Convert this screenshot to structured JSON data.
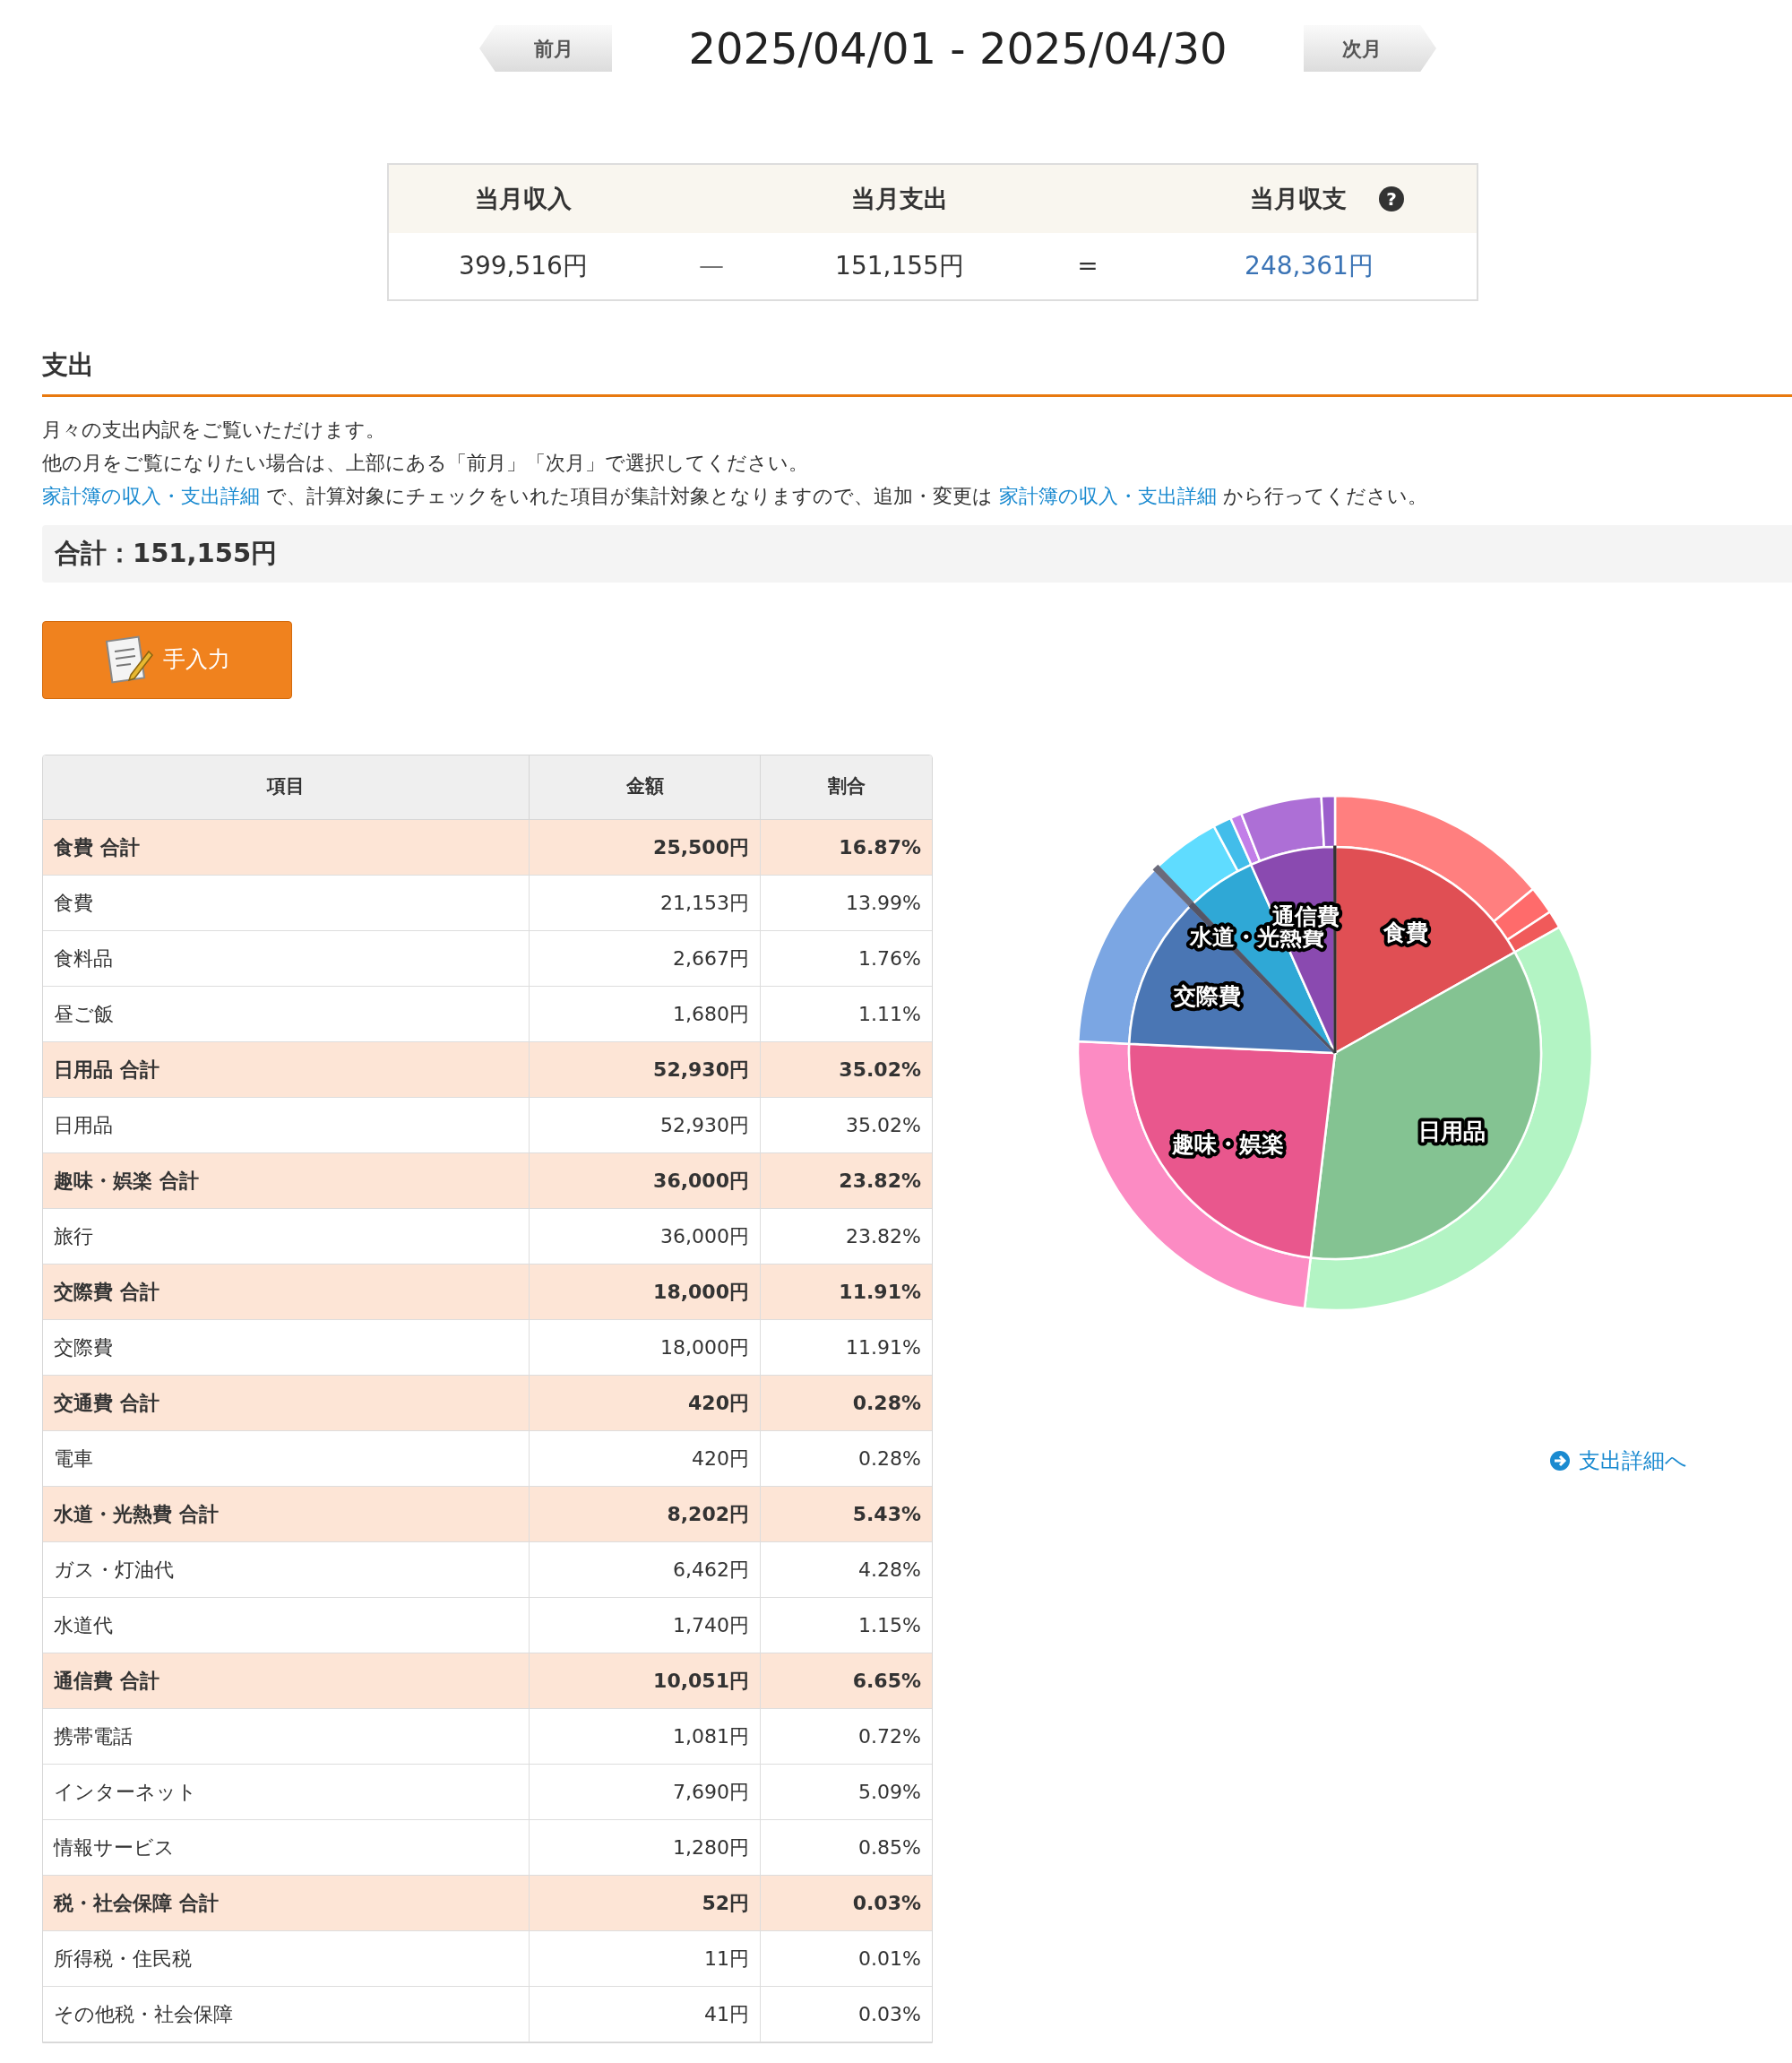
{
  "header": {
    "prev": "前月",
    "title": "2025/04/01 - 2025/04/30",
    "next": "次月"
  },
  "summary": {
    "columns": [
      "当月収入",
      "当月支出",
      "当月収支"
    ],
    "help": "?",
    "income": "399,516円",
    "minus": "—",
    "expense": "151,155円",
    "equals": "=",
    "balance": "248,361円"
  },
  "section": {
    "title": "支出",
    "lines": [
      {
        "text": "月々の支出内訳をご覧いただけます。"
      },
      {
        "text": "他の月をご覧になりたい場合は、上部にある「前月」「次月」で選択してください。"
      },
      {
        "parts": [
          {
            "link": "家計簿の収入・支出詳細"
          },
          {
            "text": " で、計算対象にチェックをいれた項目が集計対象となりますので、追加・変更は "
          },
          {
            "link": "家計簿の収入・支出詳細"
          },
          {
            "text": " から行ってください。"
          }
        ]
      }
    ],
    "total": "合計：151,155円",
    "manual_button": "手入力"
  },
  "table": {
    "columns": [
      "項目",
      "金額",
      "割合"
    ],
    "groups": [
      {
        "label": "食費 合計",
        "amount": "25,500円",
        "percent": "16.87%",
        "items": [
          {
            "label": "食費",
            "amount": "21,153円",
            "percent": "13.99%"
          },
          {
            "label": "食料品",
            "amount": "2,667円",
            "percent": "1.76%"
          },
          {
            "label": "昼ご飯",
            "amount": "1,680円",
            "percent": "1.11%"
          }
        ]
      },
      {
        "label": "日用品 合計",
        "amount": "52,930円",
        "percent": "35.02%",
        "items": [
          {
            "label": "日用品",
            "amount": "52,930円",
            "percent": "35.02%"
          }
        ]
      },
      {
        "label": "趣味・娯楽 合計",
        "amount": "36,000円",
        "percent": "23.82%",
        "items": [
          {
            "label": "旅行",
            "amount": "36,000円",
            "percent": "23.82%"
          }
        ]
      },
      {
        "label": "交際費 合計",
        "amount": "18,000円",
        "percent": "11.91%",
        "items": [
          {
            "label": "交際費",
            "amount": "18,000円",
            "percent": "11.91%"
          }
        ]
      },
      {
        "label": "交通費 合計",
        "amount": "420円",
        "percent": "0.28%",
        "items": [
          {
            "label": "電車",
            "amount": "420円",
            "percent": "0.28%"
          }
        ]
      },
      {
        "label": "水道・光熱費 合計",
        "amount": "8,202円",
        "percent": "5.43%",
        "items": [
          {
            "label": "ガス・灯油代",
            "amount": "6,462円",
            "percent": "4.28%"
          },
          {
            "label": "水道代",
            "amount": "1,740円",
            "percent": "1.15%"
          }
        ]
      },
      {
        "label": "通信費 合計",
        "amount": "10,051円",
        "percent": "6.65%",
        "items": [
          {
            "label": "携帯電話",
            "amount": "1,081円",
            "percent": "0.72%"
          },
          {
            "label": "インターネット",
            "amount": "7,690円",
            "percent": "5.09%"
          },
          {
            "label": "情報サービス",
            "amount": "1,280円",
            "percent": "0.85%"
          }
        ]
      },
      {
        "label": "税・社会保障 合計",
        "amount": "52円",
        "percent": "0.03%",
        "items": [
          {
            "label": "所得税・住民税",
            "amount": "11円",
            "percent": "0.01%"
          },
          {
            "label": "その他税・社会保障",
            "amount": "41円",
            "percent": "0.03%"
          }
        ]
      }
    ]
  },
  "chart_data": {
    "type": "pie",
    "series": [
      {
        "values": [
          16.87,
          35.02,
          23.82,
          11.91,
          0.28,
          5.43,
          6.65,
          0.03
        ],
        "colors": [
          "#e04f54",
          "#84c392",
          "#e9578d",
          "#4a76b4",
          "#555566",
          "#2fa8d6",
          "#8a4ab0",
          "#333333"
        ]
      },
      {
        "values": [
          13.99,
          1.76,
          1.11,
          35.02,
          23.82,
          11.91,
          0.28,
          4.28,
          1.15,
          0.72,
          5.09,
          0.85
        ],
        "colors": [
          "#ff7f7f",
          "#ff6b6b",
          "#f05a5a",
          "#b3f4c4",
          "#fc8bc3",
          "#7ba6e3",
          "#6b6b7b",
          "#5fdcff",
          "#42bdea",
          "#c27ee8",
          "#ad6fd6",
          "#9b5fcc"
        ]
      }
    ],
    "value_labels": [
      "食費",
      "日用品",
      "趣味・娯楽",
      "交際費",
      null,
      "水道・光熱費",
      "通信費",
      null
    ]
  },
  "detail_link": "支出詳細へ"
}
